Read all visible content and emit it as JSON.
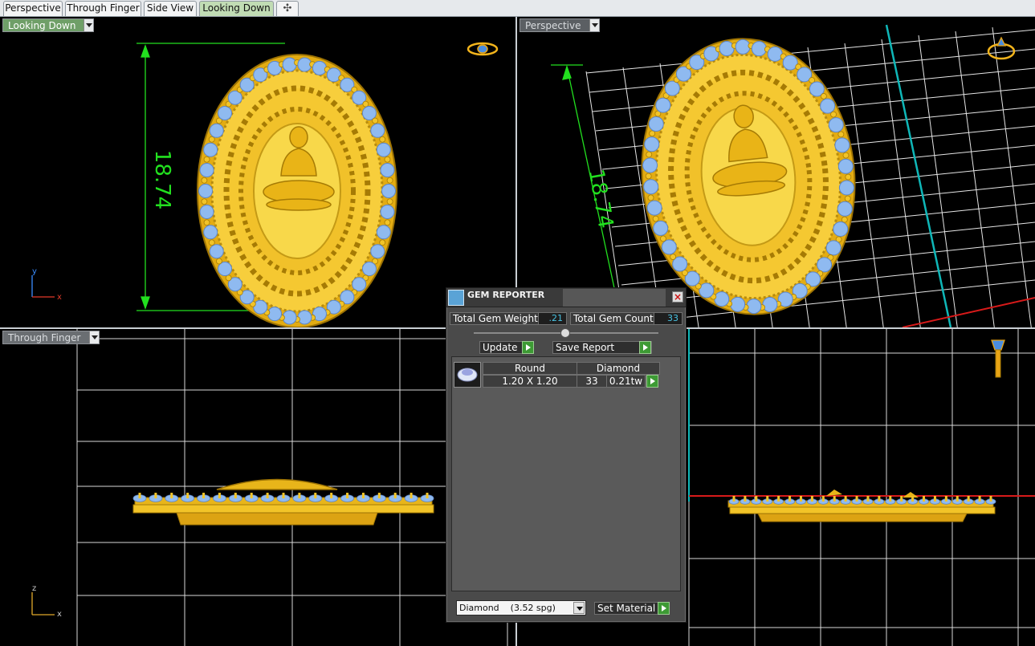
{
  "tabs": [
    {
      "label": "Perspective",
      "active": false
    },
    {
      "label": "Through Finger",
      "active": false
    },
    {
      "label": "Side View",
      "active": false
    },
    {
      "label": "Looking Down",
      "active": true
    }
  ],
  "add_tab_icon": "plus-icon",
  "viewports": {
    "top_left": {
      "label": "Looking Down",
      "dimension": "18.74",
      "axes": [
        "y",
        "x"
      ]
    },
    "top_right": {
      "label": "Perspective",
      "dimension": "18.74"
    },
    "bottom_left": {
      "label": "Through Finger",
      "axes": [
        "z",
        "x"
      ]
    },
    "bottom_right": {
      "label": ""
    }
  },
  "gem_reporter": {
    "title": "GEM REPORTER",
    "total_weight_label": "Total Gem Weight",
    "total_weight_value": ".21",
    "total_count_label": "Total Gem Count",
    "total_count_value": "33",
    "update_label": "Update",
    "save_report_label": "Save Report",
    "gems": [
      {
        "shape": "Round",
        "size": "1.20 X 1.20",
        "material": "Diamond",
        "count": "33",
        "weight": "0.21tw"
      }
    ],
    "material_select": "Diamond    (3.52 spg)",
    "set_material_label": "Set Material",
    "close_glyph": "×"
  },
  "colors": {
    "metal": "#f2c428",
    "gem": "#8fbaf0",
    "dimension": "#22e01f",
    "grid": "#ffffff",
    "active_tab": "#c1dcb4",
    "dialog_value": "#49c3e3"
  }
}
